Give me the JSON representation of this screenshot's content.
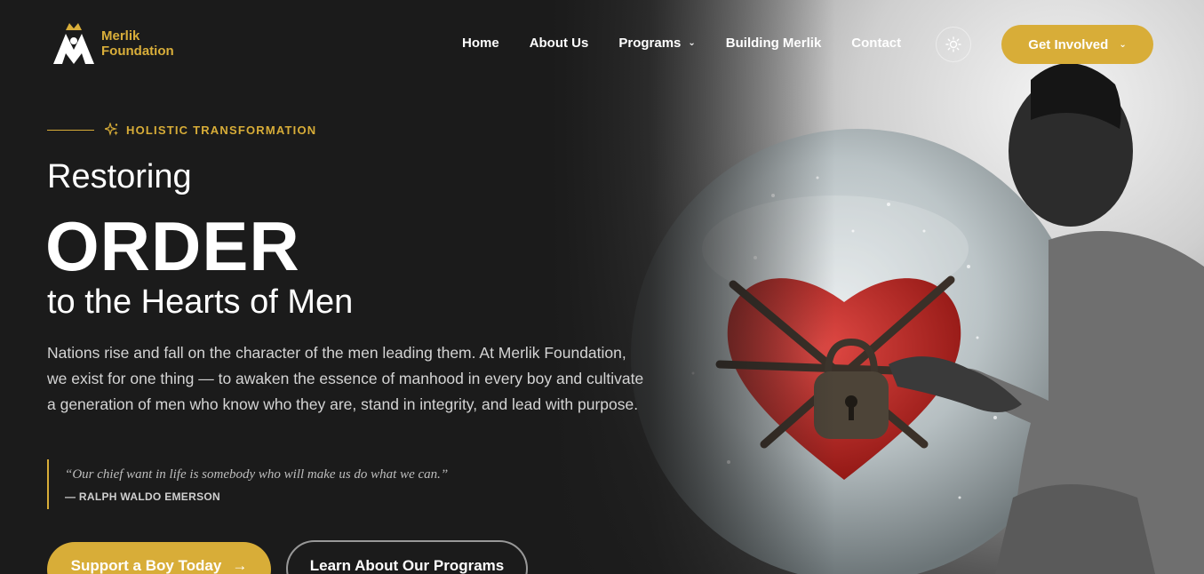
{
  "brand": {
    "name_line1": "Merlik",
    "name_line2": "Foundation",
    "accent_color": "#d8ad38"
  },
  "nav": {
    "items": [
      {
        "label": "Home"
      },
      {
        "label": "About Us"
      },
      {
        "label": "Programs",
        "has_dropdown": true
      },
      {
        "label": "Building Merlik"
      },
      {
        "label": "Contact"
      }
    ],
    "theme_toggle_icon": "sun-icon",
    "cta_label": "Get Involved"
  },
  "hero": {
    "eyebrow": "HOLISTIC TRANSFORMATION",
    "eyebrow_icon": "sparkles-icon",
    "title_line1": "Restoring",
    "title_line2": "ORDER",
    "title_line3": "to the Hearts of Men",
    "lead": "Nations rise and fall on the character of the men leading them. At Merlik Foundation, we exist for one thing — to awaken the essence of manhood in every boy and cultivate a generation of men who know who they are, stand in integrity, and lead with purpose.",
    "quote_text": "“Our chief want in life is somebody who will make us do what we can.”",
    "quote_author": "— RALPH WALDO EMERSON",
    "primary_button": "Support a Boy Today",
    "secondary_button": "Learn About Our Programs"
  }
}
